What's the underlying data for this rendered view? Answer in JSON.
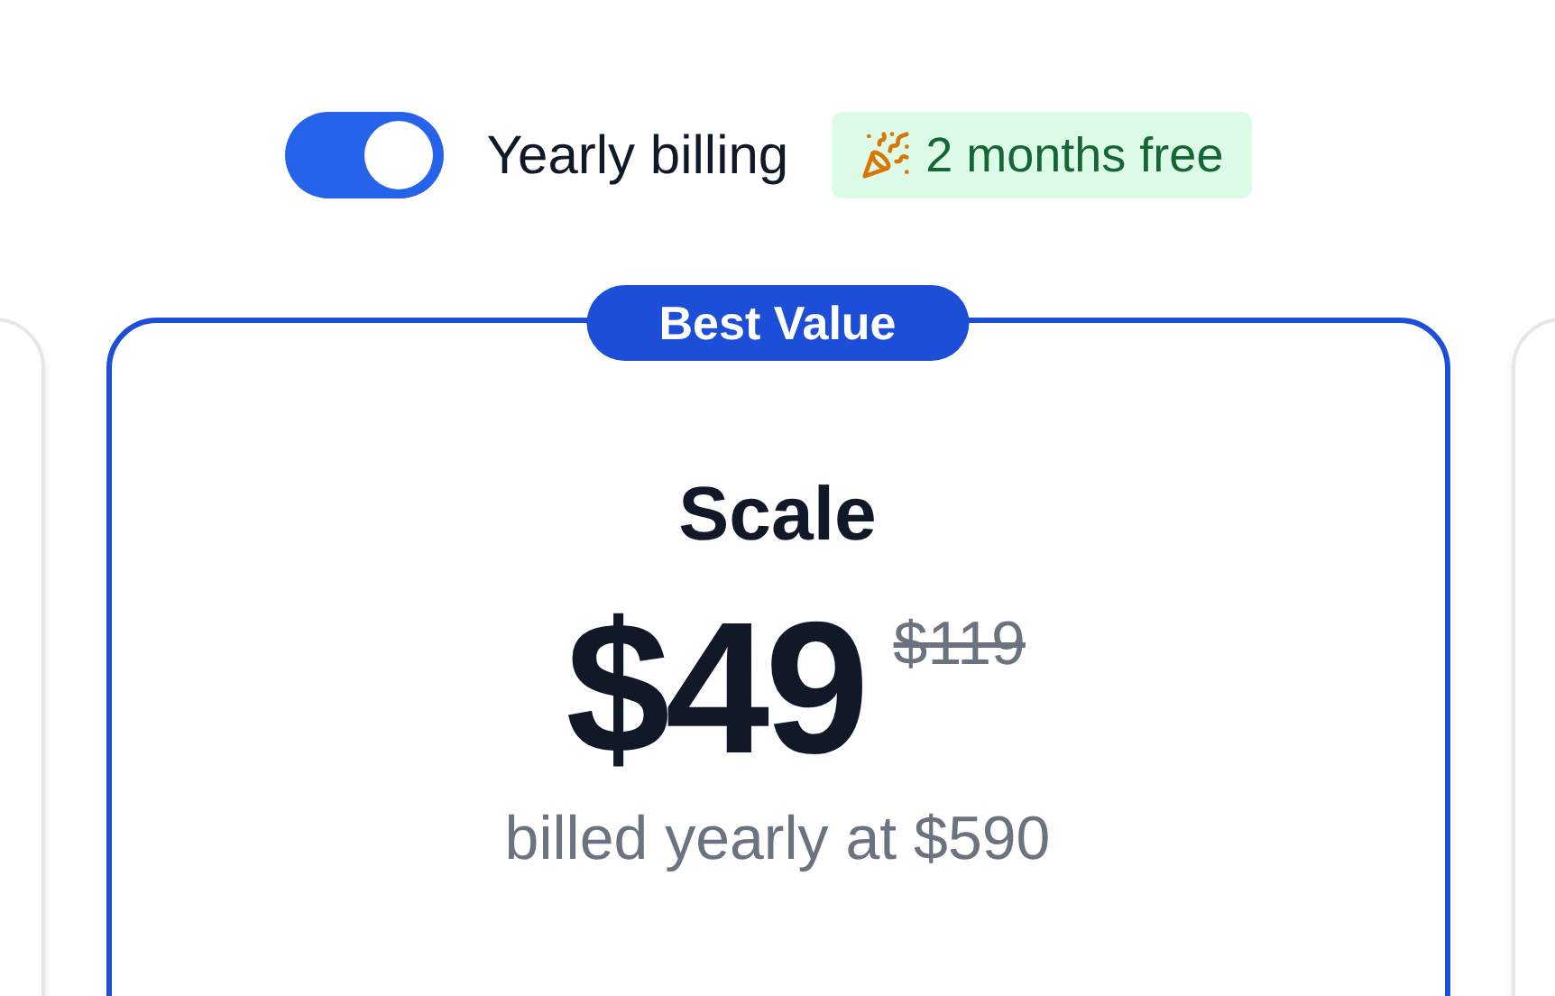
{
  "billing_toggle": {
    "label": "Yearly billing",
    "on": true
  },
  "promo_badge": {
    "text": "2 months free"
  },
  "plan": {
    "ribbon": "Best Value",
    "name": "Scale",
    "price": "$49",
    "old_price": "$119",
    "billing_note": "billed yearly at $590",
    "highlighted": true
  }
}
